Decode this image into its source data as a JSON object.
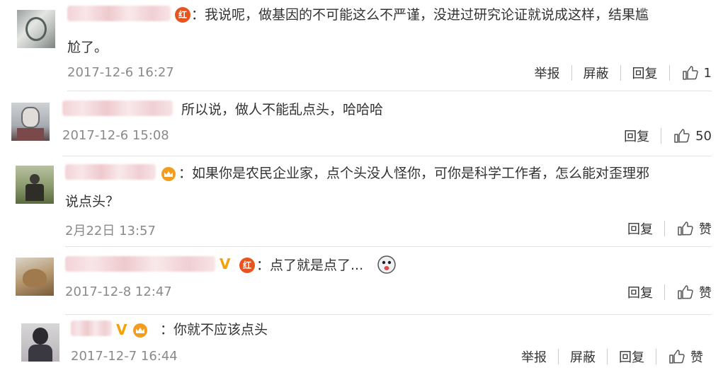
{
  "comments": [
    {
      "text_line1": "：我说呢，做基因的不可能这么不严谨，没进过研究论证就说成这样，结果尴",
      "text_line2": "尬了。",
      "time": "2017-12-6 16:27",
      "report_label": "举报",
      "block_label": "屏蔽",
      "reply_label": "回复",
      "like_count": "1",
      "badge_text": "红"
    },
    {
      "text_line1": "所以说，做人不能乱点头，哈哈哈",
      "time": "2017-12-6 15:08",
      "reply_label": "回复",
      "like_count": "50"
    },
    {
      "text_line1": "：如果你是农民企业家，点个头没人怪你，可你是科学工作者，怎么能对歪理邪",
      "text_line2": "说点头？",
      "time": "2月22日 13:57",
      "reply_label": "回复",
      "like_label": "赞"
    },
    {
      "text_line1": "：点了就是点了...",
      "time": "2017-12-8 12:47",
      "reply_label": "回复",
      "like_label": "赞",
      "badge_text": "红"
    },
    {
      "text_line1": "：你就不应该点头",
      "time": "2017-12-7 16:44",
      "report_label": "举报",
      "block_label": "屏蔽",
      "reply_label": "回复",
      "like_label": "赞"
    }
  ],
  "colors": {
    "badge_red": "#e8541d",
    "vip_gold": "#f5a10a",
    "time_gray": "#8a8a8a",
    "divider": "#e2e2e2"
  },
  "icons": [
    "thumbs-up-icon",
    "red-badge-icon",
    "vip-badge-icon",
    "emoji-icon"
  ]
}
